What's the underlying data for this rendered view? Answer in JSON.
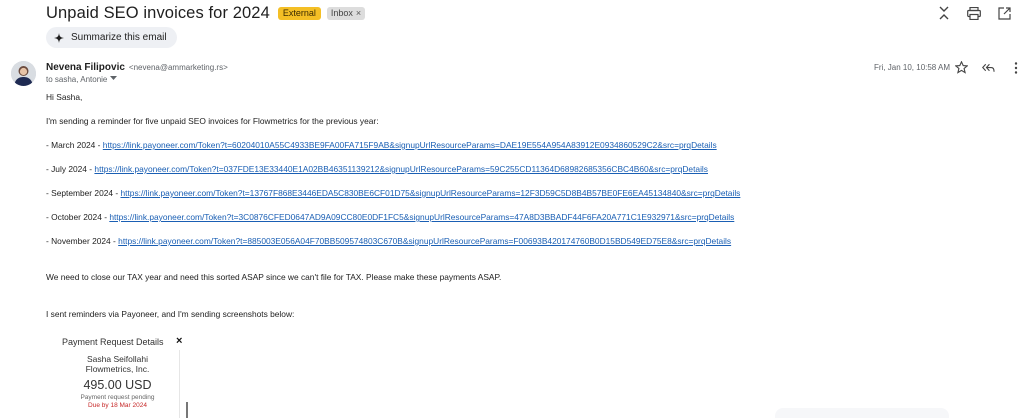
{
  "subject": "Unpaid SEO invoices for 2024",
  "labels": {
    "external": "External",
    "inbox": "Inbox",
    "inbox_remove": "×"
  },
  "summarize_label": "Summarize this email",
  "sender": {
    "name": "Nevena Filipovic",
    "email": "<nevena@ammarketing.rs>",
    "to": "to sasha, Antonie"
  },
  "date": "Fri, Jan 10, 10:58 AM",
  "body": {
    "greeting": "Hi Sasha,",
    "intro": "I'm sending a reminder for five unpaid SEO invoices for Flowmetrics for the previous year:",
    "invoices": [
      {
        "prefix": "- March 2024 - ",
        "link": "https://link.payoneer.com/Token?t=60204010A55C4933BE9FA00FA715F9AB&signupUrlResourceParams=DAE19E554A954A83912E0934860529C2&src=prqDetails"
      },
      {
        "prefix": "- July 2024 - ",
        "link": "https://link.payoneer.com/Token?t=037FDE13E33440E1A02BB46351139212&signupUrlResourceParams=59C255CD11364D68982685356CBC4B60&src=prqDetails"
      },
      {
        "prefix": "- September 2024 - ",
        "link": "https://link.payoneer.com/Token?t=13767F868E3446EDA5C830BE6CF01D75&signupUrlResourceParams=12F3D59C5D8B4B57BE0FE6EA45134840&src=prqDetails"
      },
      {
        "prefix": "- October 2024 - ",
        "link": "https://link.payoneer.com/Token?t=3C0876CFED0647AD9A09CC80E0DF1FC5&signupUrlResourceParams=47A8D3BBADF44F6FA20A771C1E932971&src=prqDetails"
      },
      {
        "prefix": "- November 2024 - ",
        "link": "https://link.payoneer.com/Token?t=885003E056A04F70BB509574803C670B&signupUrlResourceParams=F00693B420174760B0D15BD549ED75E8&src=prqDetails"
      }
    ],
    "tax_note": "We need to close our TAX year and need this sorted ASAP since we can't file for TAX. Please make these payments ASAP.",
    "reminder_note": "I sent reminders via Payoneer, and I'm sending screenshots below:"
  },
  "payment_card": {
    "title": "Payment Request Details",
    "close": "×",
    "name": "Sasha Seifollahi",
    "org": "Flowmetrics, Inc.",
    "amount": "495.00 USD",
    "status": "Payment request pending",
    "due": "Due by 18 Mar 2024"
  },
  "colors": {
    "external_badge": "#f4bf25",
    "link": "#1a5fb4",
    "due": "#c62828"
  }
}
